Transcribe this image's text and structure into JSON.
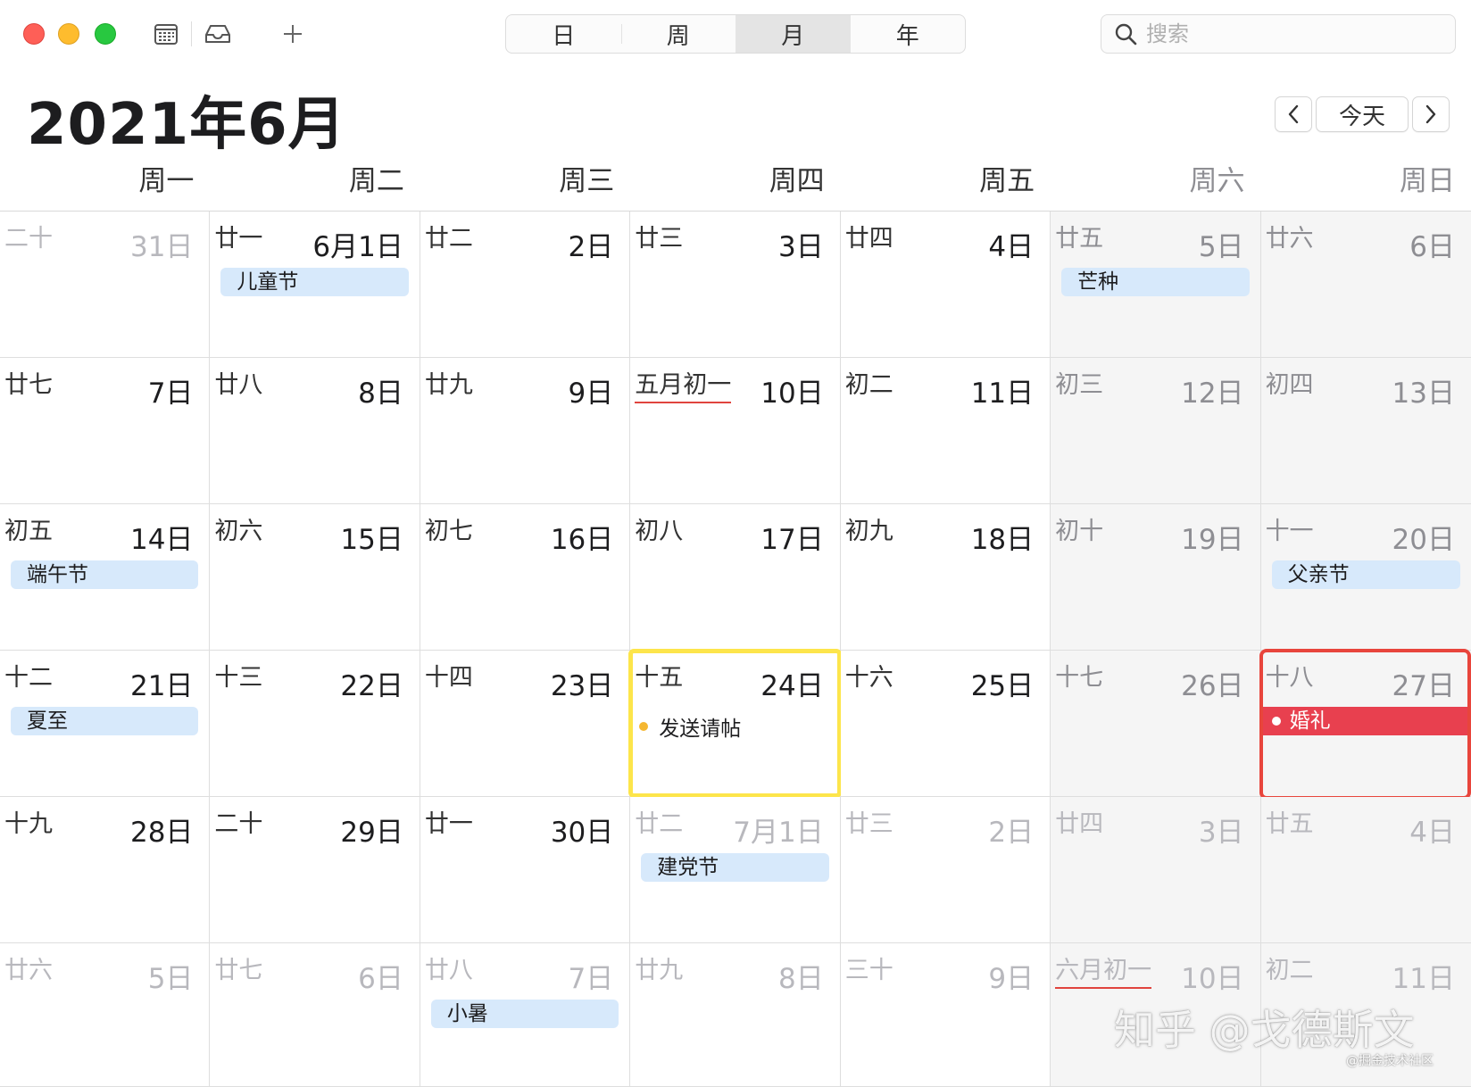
{
  "toolbar": {
    "views": [
      "日",
      "周",
      "月",
      "年"
    ],
    "active_view": "月",
    "search_placeholder": "搜索"
  },
  "header": {
    "title": "2021年6月",
    "prev": "<",
    "today": "今天",
    "next": ">"
  },
  "weekdays": [
    "周一",
    "周二",
    "周三",
    "周四",
    "周五",
    "周六",
    "周日"
  ],
  "weeks": [
    [
      {
        "lunar": "二十",
        "day": "31日",
        "other": true
      },
      {
        "lunar": "廿一",
        "day": "6月1日",
        "event": "儿童节"
      },
      {
        "lunar": "廿二",
        "day": "2日"
      },
      {
        "lunar": "廿三",
        "day": "3日"
      },
      {
        "lunar": "廿四",
        "day": "4日"
      },
      {
        "lunar": "廿五",
        "day": "5日",
        "event": "芒种"
      },
      {
        "lunar": "廿六",
        "day": "6日"
      }
    ],
    [
      {
        "lunar": "廿七",
        "day": "7日"
      },
      {
        "lunar": "廿八",
        "day": "8日"
      },
      {
        "lunar": "廿九",
        "day": "9日"
      },
      {
        "lunar": "五月初一",
        "day": "10日",
        "underline": true
      },
      {
        "lunar": "初二",
        "day": "11日"
      },
      {
        "lunar": "初三",
        "day": "12日"
      },
      {
        "lunar": "初四",
        "day": "13日"
      }
    ],
    [
      {
        "lunar": "初五",
        "day": "14日",
        "event": "端午节"
      },
      {
        "lunar": "初六",
        "day": "15日"
      },
      {
        "lunar": "初七",
        "day": "16日"
      },
      {
        "lunar": "初八",
        "day": "17日"
      },
      {
        "lunar": "初九",
        "day": "18日"
      },
      {
        "lunar": "初十",
        "day": "19日"
      },
      {
        "lunar": "十一",
        "day": "20日",
        "event": "父亲节"
      }
    ],
    [
      {
        "lunar": "十二",
        "day": "21日",
        "event": "夏至"
      },
      {
        "lunar": "十三",
        "day": "22日"
      },
      {
        "lunar": "十四",
        "day": "23日"
      },
      {
        "lunar": "十五",
        "day": "24日",
        "dot_event": "发送请帖",
        "highlight": "yellow"
      },
      {
        "lunar": "十六",
        "day": "25日"
      },
      {
        "lunar": "十七",
        "day": "26日"
      },
      {
        "lunar": "十八",
        "day": "27日",
        "red_event": "婚礼",
        "highlight": "red"
      }
    ],
    [
      {
        "lunar": "十九",
        "day": "28日"
      },
      {
        "lunar": "二十",
        "day": "29日"
      },
      {
        "lunar": "廿一",
        "day": "30日"
      },
      {
        "lunar": "廿二",
        "day": "7月1日",
        "other": true,
        "event": "建党节"
      },
      {
        "lunar": "廿三",
        "day": "2日",
        "other": true
      },
      {
        "lunar": "廿四",
        "day": "3日",
        "other": true
      },
      {
        "lunar": "廿五",
        "day": "4日",
        "other": true
      }
    ],
    [
      {
        "lunar": "廿六",
        "day": "5日",
        "other": true
      },
      {
        "lunar": "廿七",
        "day": "6日",
        "other": true
      },
      {
        "lunar": "廿八",
        "day": "7日",
        "other": true,
        "event": "小暑"
      },
      {
        "lunar": "廿九",
        "day": "8日",
        "other": true
      },
      {
        "lunar": "三十",
        "day": "9日",
        "other": true
      },
      {
        "lunar": "六月初一",
        "day": "10日",
        "other": true,
        "underline": true
      },
      {
        "lunar": "初二",
        "day": "11日",
        "other": true
      }
    ]
  ],
  "watermark": "知乎 @戈德斯文",
  "watermark_small": "@掘金技术社区",
  "colors": {
    "event_blue": "#d7e9fb",
    "event_red": "#e8404f",
    "dot_yellow": "#f5b731",
    "highlight_yellow": "#fde54b",
    "highlight_red": "#e8453c"
  }
}
